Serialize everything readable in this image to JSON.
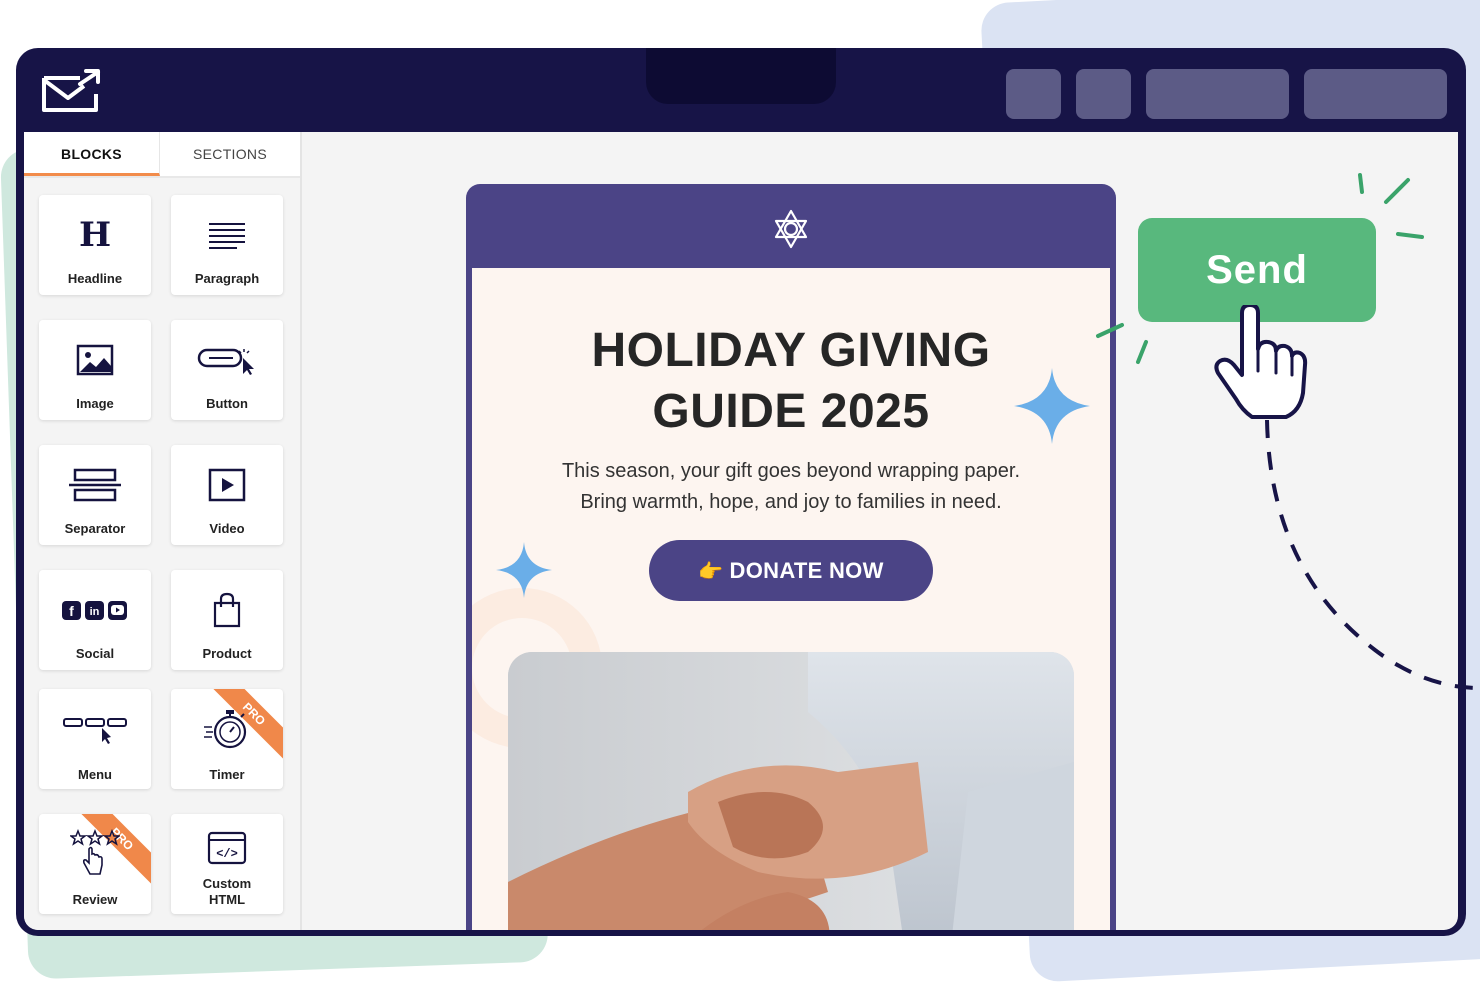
{
  "app": {
    "logo_icon": "mail-send-icon",
    "toolbar_buttons": [
      "toolbar-button-1",
      "toolbar-button-2",
      "toolbar-button-3",
      "toolbar-button-4"
    ]
  },
  "sidebar": {
    "tabs": [
      {
        "label": "BLOCKS",
        "active": true
      },
      {
        "label": "SECTIONS",
        "active": false
      }
    ],
    "blocks": [
      {
        "label": "Headline",
        "icon": "headline-icon"
      },
      {
        "label": "Paragraph",
        "icon": "paragraph-icon"
      },
      {
        "label": "Image",
        "icon": "image-icon"
      },
      {
        "label": "Button",
        "icon": "button-icon"
      },
      {
        "label": "Separator",
        "icon": "separator-icon"
      },
      {
        "label": "Video",
        "icon": "video-icon"
      },
      {
        "label": "Social",
        "icon": "social-icon"
      },
      {
        "label": "Product",
        "icon": "shopping-bag-icon"
      },
      {
        "label": "Menu",
        "icon": "menu-icon"
      },
      {
        "label": "Timer",
        "icon": "stopwatch-icon",
        "badge": "PRO"
      },
      {
        "label": "Review",
        "icon": "review-stars-icon",
        "badge": "PRO"
      },
      {
        "label": "Custom\nHTML",
        "label_line1": "Custom",
        "label_line2": "HTML",
        "icon": "code-icon"
      }
    ]
  },
  "email": {
    "header_icon": "star-of-david-icon",
    "headline": "HOLIDAY GIVING GUIDE 2025",
    "subtext_line1": "This season, your gift goes beyond wrapping paper.",
    "subtext_line2": "Bring warmth, hope, and joy to families in need.",
    "donate_emoji": "👉",
    "donate_label": "DONATE NOW",
    "photo_icon": "holding-hands-photo"
  },
  "send": {
    "label": "Send",
    "cursor_icon": "hand-pointer-icon"
  },
  "colors": {
    "window": "#171447",
    "email_purple": "#4b4486",
    "send_green": "#58b87d",
    "pro_orange": "#f0884a",
    "sparkle_blue": "#6aaee8"
  }
}
